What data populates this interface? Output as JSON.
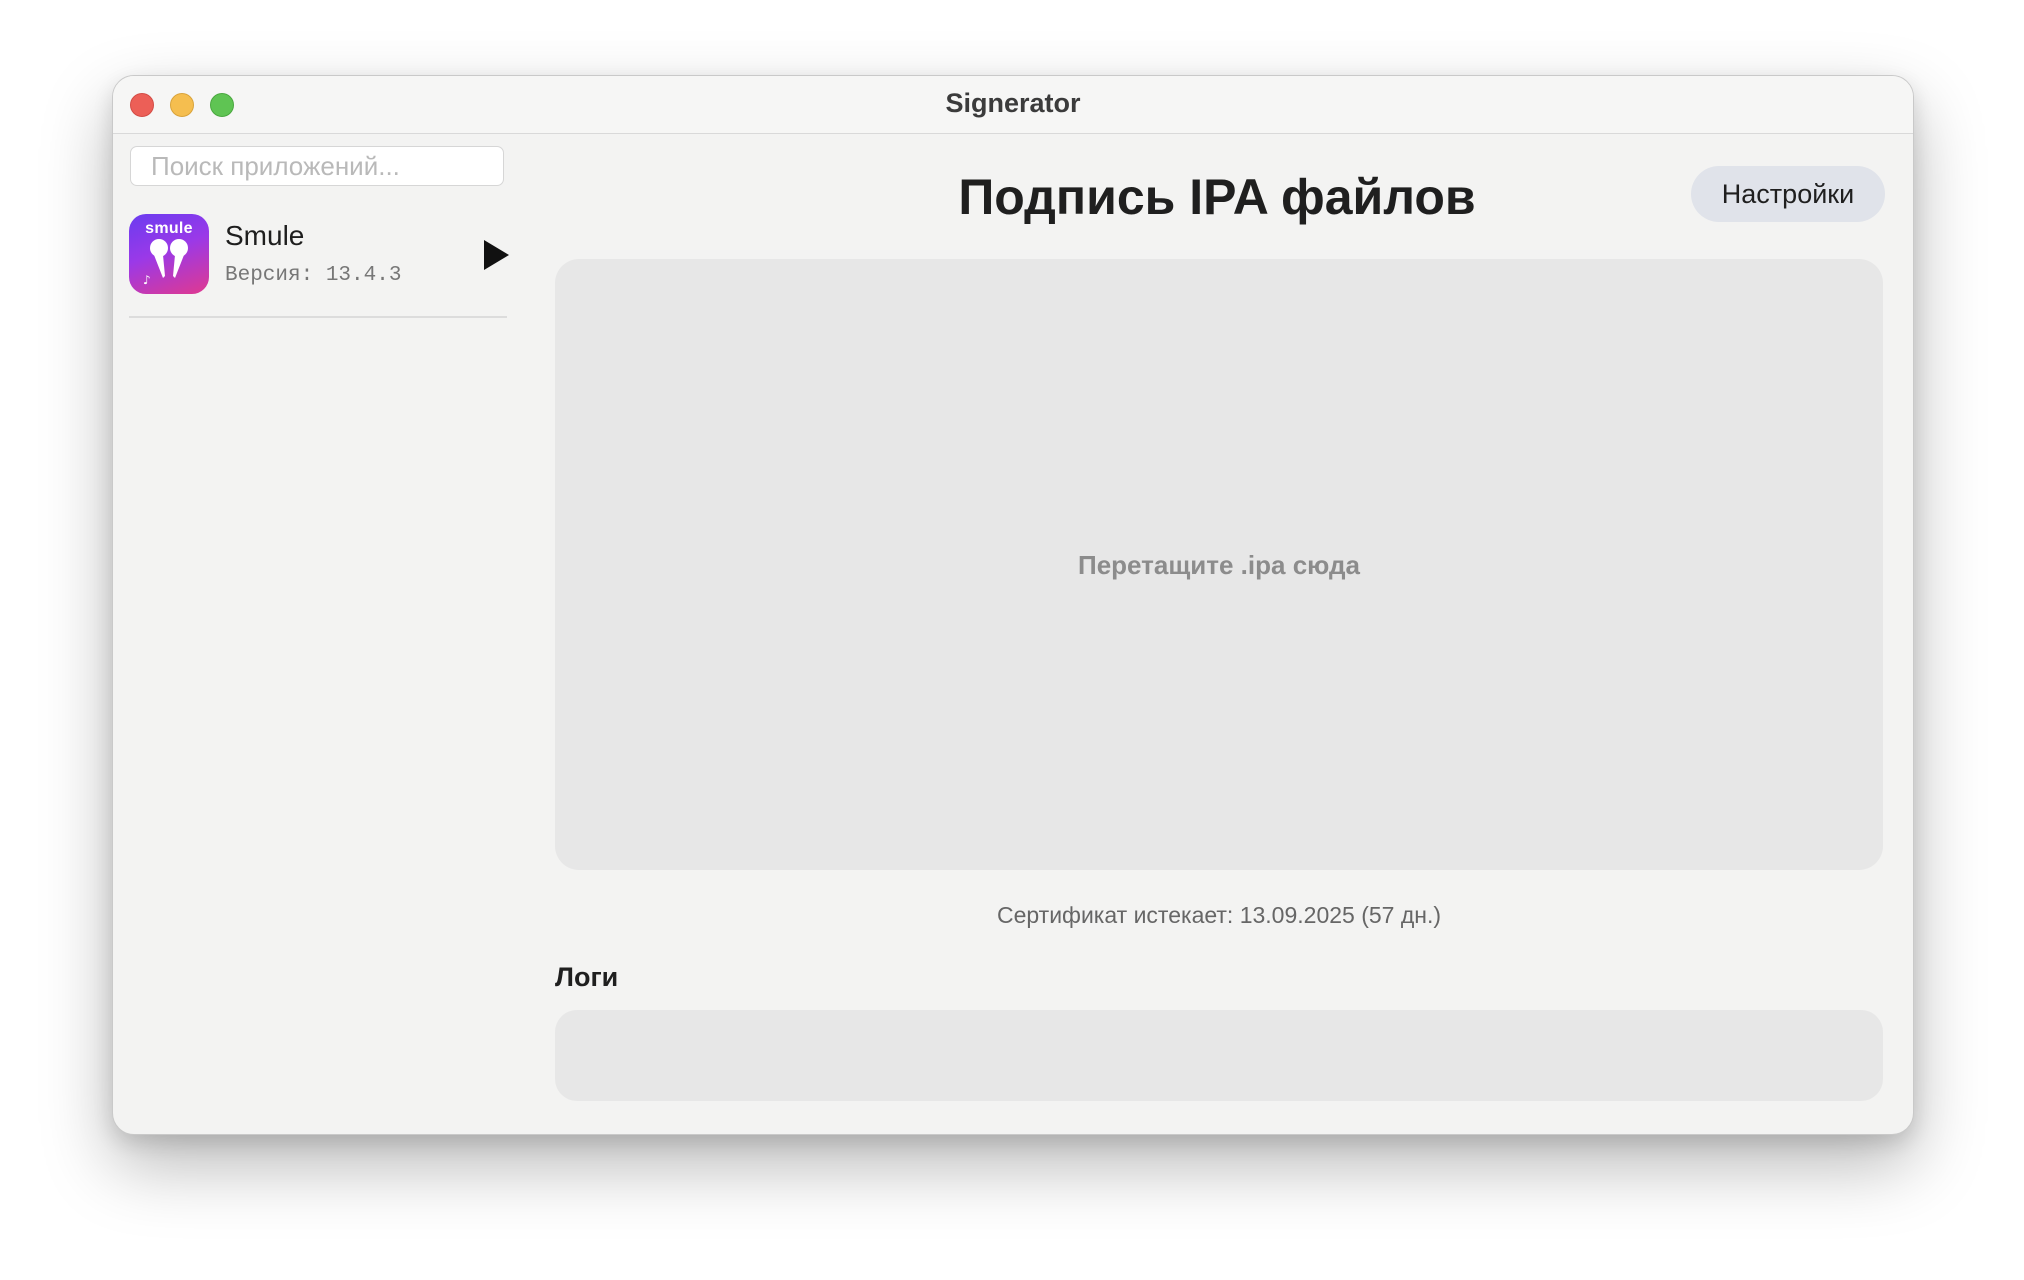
{
  "window": {
    "title": "Signerator"
  },
  "sidebar": {
    "search_placeholder": "Поиск приложений...",
    "apps": [
      {
        "icon_text": "smule",
        "name": "Smule",
        "version": "Версия: 13.4.3",
        "action_icon": "play-icon"
      }
    ]
  },
  "main": {
    "title": "Подпись IPA файлов",
    "settings_label": "Настройки",
    "dropzone_text": "Перетащите .ipa сюда",
    "certificate_text": "Сертификат истекает: 13.09.2025 (57 дн.)",
    "logs_label": "Логи",
    "logs_content": ""
  },
  "colors": {
    "close": "#ec5f57",
    "minimize": "#f5be4f",
    "maximize": "#5fc453",
    "app_icon_gradient": [
      "#6a3cf0",
      "#e0398f"
    ],
    "settings_button_bg": "#e0e3ea",
    "dropzone_bg": "#e7e7e7"
  }
}
